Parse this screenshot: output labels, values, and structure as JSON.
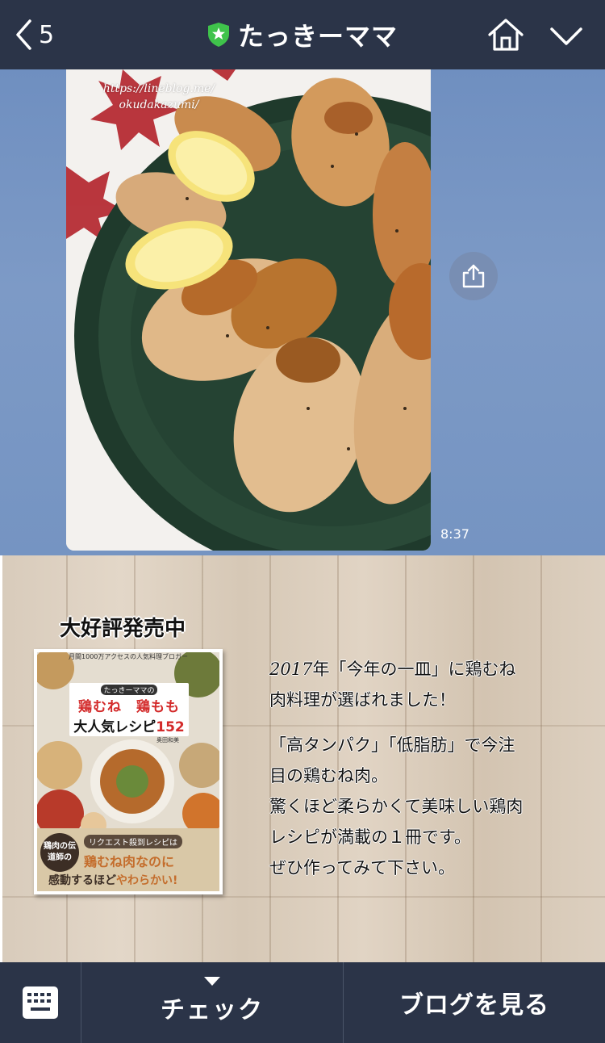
{
  "header": {
    "back_count": "5",
    "title": "たっきーママ",
    "official_badge_icon": "green-shield-star-icon",
    "home_icon": "home-icon",
    "menu_icon": "chevron-down-icon"
  },
  "message": {
    "photo_watermark_line1": "https://lineblog.me/",
    "photo_watermark_line2": "okudakazumi/",
    "time": "8:37",
    "share_icon": "share-icon"
  },
  "banner": {
    "heading": "大好評発売中",
    "book": {
      "top_note": "月間1000万アクセスの人気料理ブロガー",
      "series": "たっきーママの",
      "title_line1": "鶏むね　鶏もも",
      "title_line2_text": "大人気レシピ",
      "title_line2_num": "152",
      "author": "奥田和美",
      "badge": "鶏肉の伝道師の",
      "line1": "リクエスト殺到レシピは",
      "line2": "鶏むね肉なのに",
      "line3_a": "感動するほど",
      "line3_b": "やわらかい!"
    },
    "text": {
      "p1_year": "2017",
      "p1_rest_line1": "年「今年の一皿」に鶏むね",
      "p1_line2": "肉料理が選ばれました！",
      "p2_line1": "「高タンパク」「低脂肪」で今注",
      "p2_line2": "目の鶏むね肉。",
      "p2_line3": "驚くほど柔らかくて美味しい鶏肉",
      "p2_line4": "レシピが満載の１冊です。",
      "p2_line5": "ぜひ作ってみて下さい。"
    }
  },
  "bottom_bar": {
    "keyboard_icon": "keyboard-icon",
    "check_label": "チェック",
    "blog_label": "ブログを見る"
  },
  "colors": {
    "header_bg": "#2b3448",
    "chat_bg": "#7594c2",
    "badge_green": "#3fc34b"
  }
}
